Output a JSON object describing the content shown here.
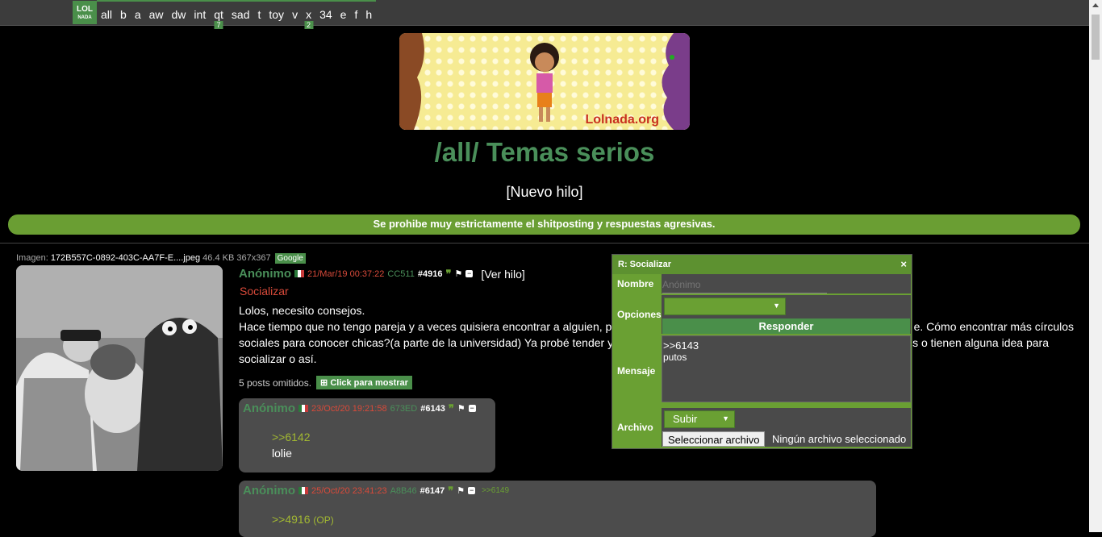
{
  "nav": {
    "logo_top": "LOL",
    "logo_bottom": "NADA",
    "links": [
      {
        "label": "all"
      },
      {
        "label": "b"
      },
      {
        "label": "a"
      },
      {
        "label": "aw"
      },
      {
        "label": "dw"
      },
      {
        "label": "int"
      },
      {
        "label": "qt",
        "badge": "7"
      },
      {
        "label": "sad"
      },
      {
        "label": "t"
      },
      {
        "label": "toy"
      },
      {
        "label": "v"
      },
      {
        "label": "x",
        "badge": "2"
      },
      {
        "label": "34"
      },
      {
        "label": "e"
      },
      {
        "label": "f"
      },
      {
        "label": "h"
      }
    ]
  },
  "banner": {
    "text": "Lolnada.org"
  },
  "board": {
    "title": "/all/ Temas serios",
    "new_thread": "[Nuevo hilo]",
    "rules": "Se prohibe muy estrictamente el shitposting y respuestas agresivas."
  },
  "op": {
    "file_label": "Imagen:",
    "file_name": "172B557C-0892-403C-AA7F-E....jpeg",
    "file_meta": "46.4 KB 367x367",
    "google": "Google",
    "name": "Anónimo",
    "date": "21/Mar/19 00:37:22",
    "id": "CC511",
    "num": "#4916",
    "quote_icon": "❞",
    "view_thread": "[Ver hilo]",
    "subject": "Socializar",
    "body_line1": "Lolos, necesito consejos.",
    "body_line2a": "Hace tiempo que no tengo pareja y a veces quisiera encontrar a alguien, p",
    "body_line2b": "e. Cómo encontrar más círculos",
    "body_line3a": "sociales para conocer chicas?(a parte de la universidad) Ya probé tender y",
    "body_line3b": "s o tienen alguna idea para",
    "body_line4": "socializar o así.",
    "omitted": "5 posts omitidos.",
    "show_label": "Click para mostrar"
  },
  "replies": [
    {
      "name": "Anónimo",
      "date": "23/Oct/20 19:21:58",
      "id": "673ED",
      "num": "#6143",
      "quote": ">>6142",
      "text": "lolie",
      "backlink": ""
    },
    {
      "name": "Anónimo",
      "date": "25/Oct/20 23:41:23",
      "id": "A8B46",
      "num": "#6147",
      "quote": ">>4916",
      "quote_op": "(OP)",
      "text": "",
      "backlink": ">>6149"
    }
  ],
  "quick_reply": {
    "title": "R: Socializar",
    "close": "×",
    "name_label": "Nombre",
    "name_placeholder": "Anónimo",
    "options_label": "Opciones",
    "options_value": "",
    "submit": "Responder",
    "message_label": "Mensaje",
    "message_line1": ">>6143",
    "message_line2": "putos",
    "file_label": "Archivo",
    "upload_select": "Subir",
    "file_button": "Seleccionar archivo",
    "no_file": "Ningún archivo seleccionado"
  },
  "colors": {
    "accent_green": "#6aa033",
    "title_green": "#4a8f5a",
    "date_red": "#d94a3a",
    "greentext": "#a2b832"
  }
}
